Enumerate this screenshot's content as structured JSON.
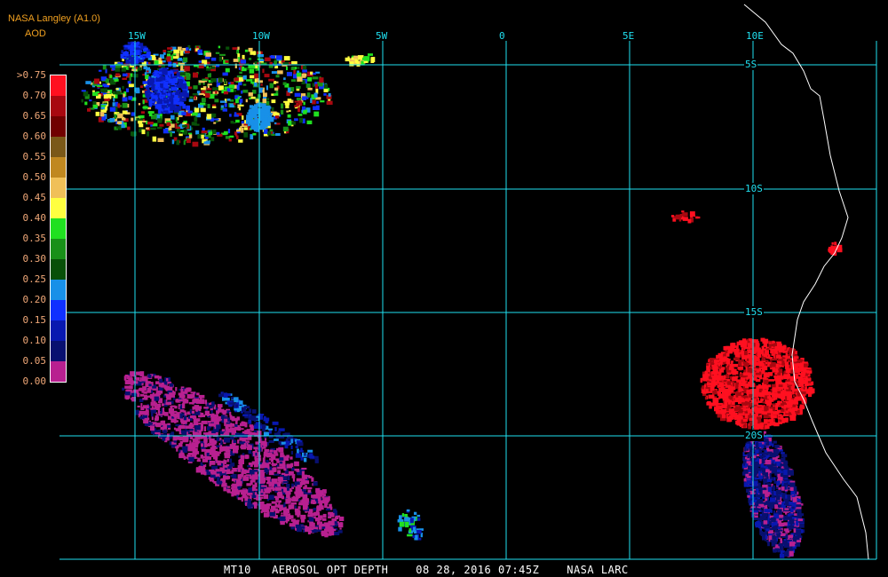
{
  "header": {
    "title": "NASA Langley (A1.0)",
    "unit": "AOD"
  },
  "legend": {
    "labels": [
      ">0.75",
      "0.70",
      "0.65",
      "0.60",
      "0.55",
      "0.50",
      "0.45",
      "0.40",
      "0.35",
      "0.30",
      "0.25",
      "0.20",
      "0.15",
      "0.10",
      "0.05",
      "0.00"
    ],
    "colors": [
      "#ff1020",
      "#a80810",
      "#700000",
      "#7a5818",
      "#c08820",
      "#f0c058",
      "#ffff40",
      "#20e020",
      "#189018",
      "#085008",
      "#1890e8",
      "#1030ff",
      "#0818b0",
      "#081070",
      "#b82090"
    ]
  },
  "grid": {
    "lon_labels": [
      "15W",
      "10W",
      "5W",
      "0",
      "5E",
      "10E"
    ],
    "lat_labels": [
      "5S",
      "10S",
      "15S",
      "20S"
    ],
    "color": "#20e0f0"
  },
  "footer": {
    "caption": "MT10   AEROSOL OPT DEPTH    08 28, 2016 07:45Z    NASA LARC"
  }
}
